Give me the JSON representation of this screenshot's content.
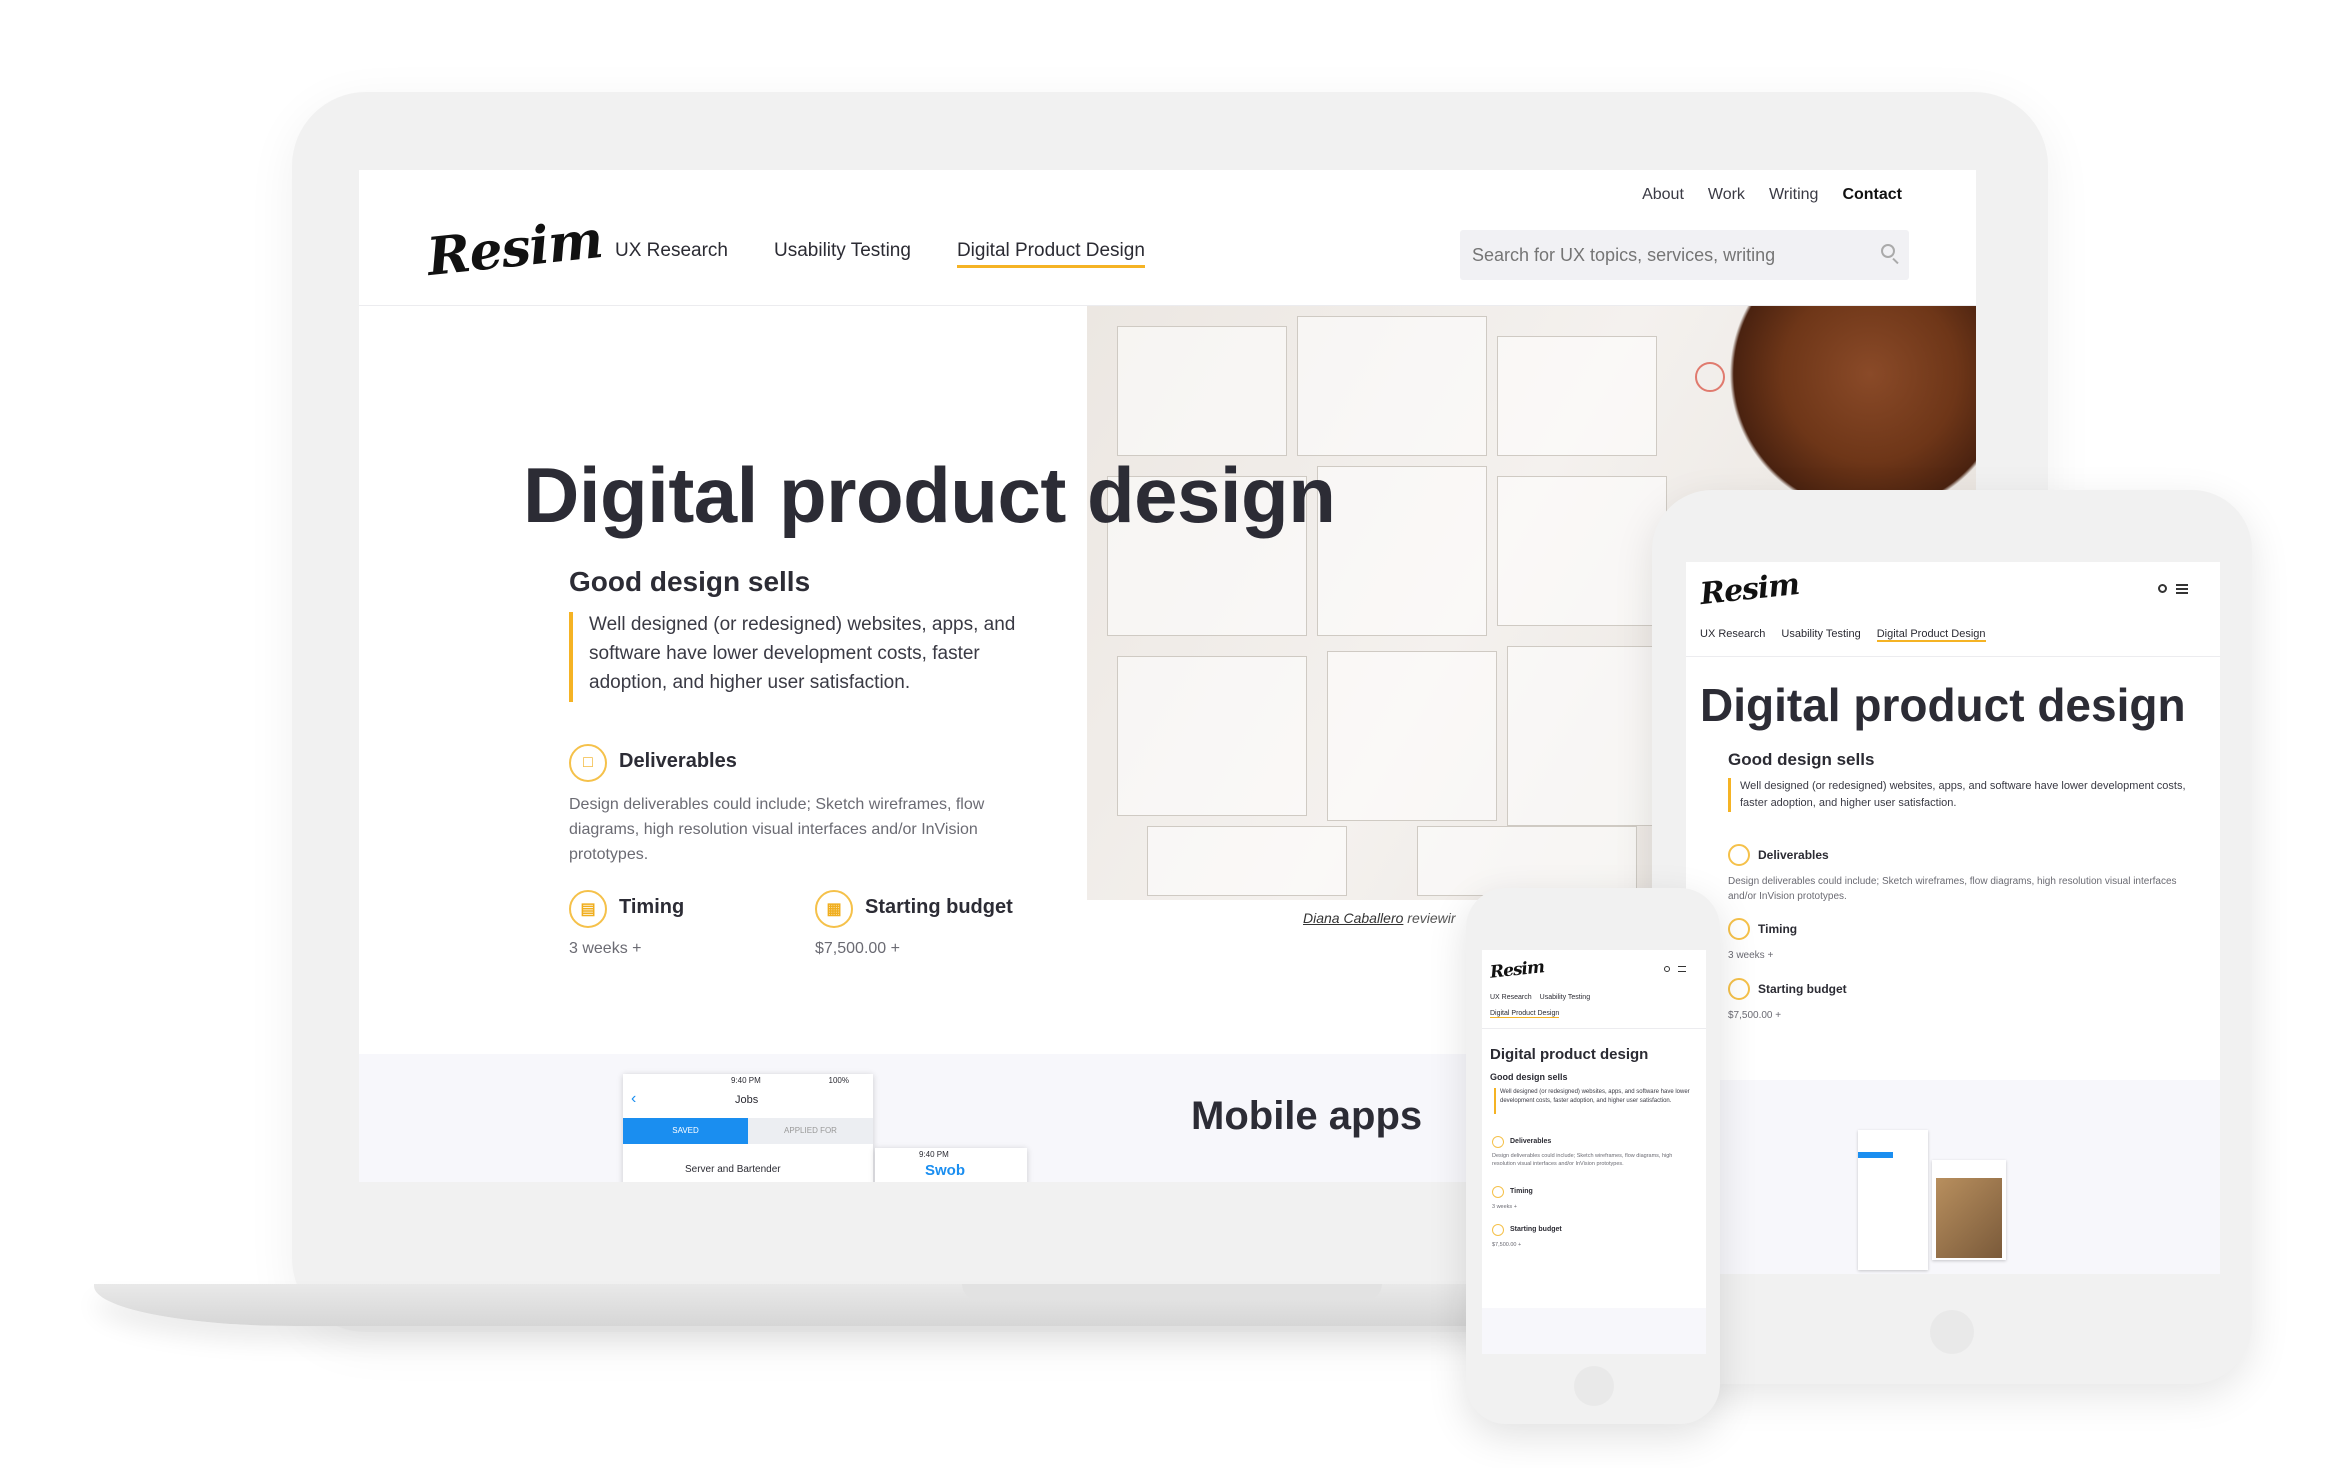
{
  "brand": {
    "name": "Resim"
  },
  "top_nav": {
    "items": [
      "About",
      "Work",
      "Writing",
      "Contact"
    ]
  },
  "main_nav": {
    "items": [
      "UX Research",
      "Usability Testing",
      "Digital Product Design"
    ]
  },
  "search": {
    "placeholder": "Search for UX topics, services, writing"
  },
  "hero": {
    "title": "Digital product design",
    "subtitle": "Good design sells",
    "quote": "Well designed (or redesigned) websites, apps, and software have lower development costs, faster adoption, and higher user satisfaction.",
    "caption_name": "Diana Caballero",
    "caption_rest": "reviewir"
  },
  "deliverables": {
    "title": "Deliverables",
    "text": "Design deliverables could include; Sketch wireframes, flow diagrams, high resolution visual interfaces and/or InVision prototypes."
  },
  "timing": {
    "title": "Timing",
    "value": "3 weeks +"
  },
  "budget": {
    "title": "Starting budget",
    "value": "$7,500.00 +"
  },
  "next_section": {
    "title": "Mobile apps"
  },
  "phone_app": {
    "status_time": "9:40 PM",
    "status_battery": "100%",
    "header": "Jobs",
    "tab_saved": "SAVED",
    "tab_applied": "APPLIED FOR",
    "job": "Server and Bartender",
    "logo": "Swob"
  },
  "colors": {
    "accent": "#f5b324",
    "blue": "#1a8ef0",
    "text": "#2b2b33",
    "muted": "#6b6b73",
    "panel": "#f7f7fb"
  }
}
